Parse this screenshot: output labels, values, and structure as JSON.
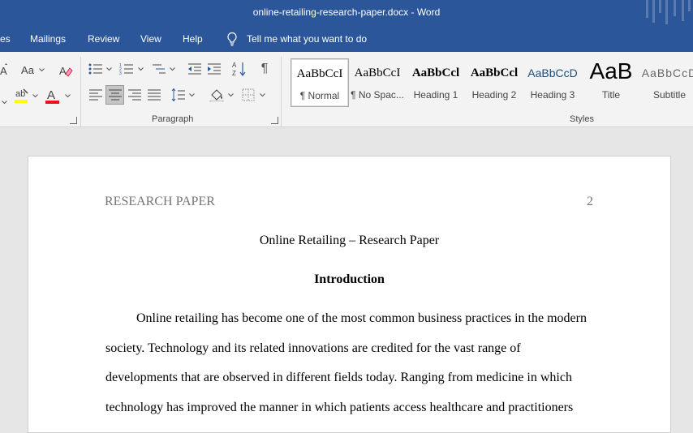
{
  "window": {
    "title": "online-retailing-research-paper.docx  -  Word"
  },
  "tabs": [
    {
      "label": "es"
    },
    {
      "label": "Mailings"
    },
    {
      "label": "Review"
    },
    {
      "label": "View"
    },
    {
      "label": "Help"
    }
  ],
  "tell_me": {
    "text": "Tell me what you want to do"
  },
  "ribbon": {
    "font_group": {
      "case_label": "Aa",
      "highlight_label": "ab"
    },
    "paragraph_group": {
      "label": "Paragraph"
    },
    "styles_group": {
      "label": "Styles",
      "items": [
        {
          "sample": "AaBbCcI",
          "name": "¶ Normal",
          "selected": true
        },
        {
          "sample": "AaBbCcI",
          "name": "¶ No Spac..."
        },
        {
          "sample": "AaBbCcl",
          "name": "Heading 1"
        },
        {
          "sample": "AaBbCcl",
          "name": "Heading 2"
        },
        {
          "sample": "AaBbCcD",
          "name": "Heading 3"
        },
        {
          "sample": "AaB",
          "name": "Title"
        },
        {
          "sample": "AaBbCcD",
          "name": "Subtitle"
        }
      ]
    }
  },
  "colors": {
    "titlebar": "#2b579a",
    "font_color": "#e81123",
    "highlight_color": "#ffff00"
  },
  "document": {
    "header_left": "RESEARCH PAPER",
    "page_number": "2",
    "title": "Online Retailing – Research Paper",
    "section_heading": "Introduction",
    "lines": [
      "Online retailing has become one of the most common business practices in the modern",
      "society. Technology and its related innovations are credited for the vast range of",
      "developments that are observed in different fields today. Ranging from medicine in which",
      "technology has improved the manner in which patients access healthcare and practitioners"
    ]
  }
}
